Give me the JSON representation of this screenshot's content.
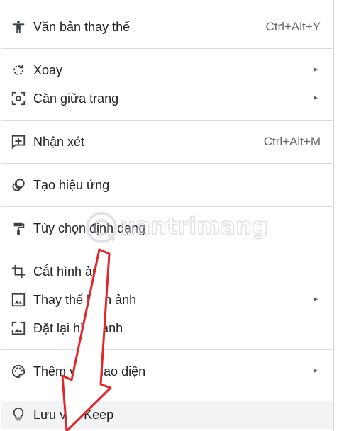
{
  "menu": {
    "items": [
      {
        "label": "Văn bản thay thế",
        "shortcut": "Ctrl+Alt+Y",
        "icon": "accessibility-icon"
      },
      {
        "label": "Xoay",
        "submenu": "►",
        "icon": "rotate-icon"
      },
      {
        "label": "Căn giữa trang",
        "submenu": "►",
        "icon": "center-on-page-icon"
      },
      {
        "label": "Nhận xét",
        "shortcut": "Ctrl+Alt+M",
        "icon": "add-comment-icon"
      },
      {
        "label": "Tạo hiệu ứng",
        "icon": "animate-icon"
      },
      {
        "label": "Tùy chọn định dạng",
        "icon": "format-paint-icon"
      },
      {
        "label": "Cắt hình ảnh",
        "icon": "crop-icon"
      },
      {
        "label": "Thay thế hình ảnh",
        "submenu": "►",
        "icon": "image-icon"
      },
      {
        "label": "Đặt lại hình ảnh",
        "icon": "reset-image-icon"
      },
      {
        "label": "Thêm vào giao diện",
        "submenu": "►",
        "icon": "palette-icon"
      },
      {
        "label": "Lưu vào Keep",
        "icon": "keep-bulb-icon"
      }
    ]
  },
  "watermark": {
    "text": "uantrimang"
  },
  "colors": {
    "annotation_arrow": "#e3262a",
    "hover_bg": "#f1f3f4",
    "divider": "#dadce0"
  }
}
